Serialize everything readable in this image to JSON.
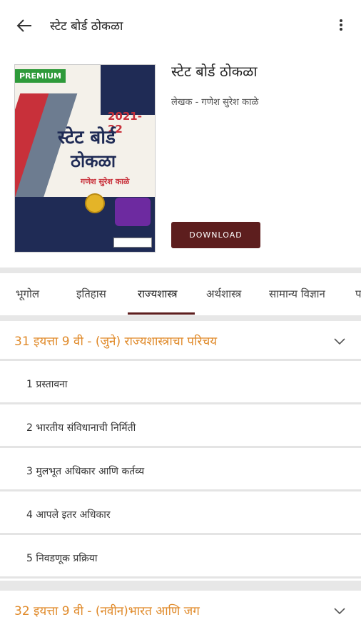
{
  "appbar": {
    "title": "स्टेट बोर्ड ठोकळा"
  },
  "book": {
    "title": "स्टेट बोर्ड ठोकळा",
    "author": "लेखक - गणेश सुरेश काळे",
    "download_label": "DOWNLOAD",
    "cover": {
      "premium": "PREMIUM",
      "year": "2021-22",
      "title_line1": "स्टेट बोर्ड",
      "title_line2": "ठोकळा",
      "author_line": "गणेश सुरेश काळे"
    }
  },
  "tabs": [
    {
      "label": "भूगोल"
    },
    {
      "label": "इतिहास"
    },
    {
      "label": "राज्यशास्त्र"
    },
    {
      "label": "अर्थशास्त्र"
    },
    {
      "label": "सामान्य विज्ञान"
    },
    {
      "label": "प"
    }
  ],
  "chapters": [
    {
      "title": "31 इयत्ता 9 वी - (जुने) राज्यशास्त्राचा परिचय",
      "lessons": [
        {
          "label": "1 प्रस्तावना"
        },
        {
          "label": "2 भारतीय संविधानाची निर्मिती"
        },
        {
          "label": "3 मुलभूत अधिकार आणि कर्तव्य"
        },
        {
          "label": "4 आपले इतर अधिकार"
        },
        {
          "label": "5 निवडणूक प्रक्रिया"
        }
      ]
    },
    {
      "title": "32 इयत्ता 9 वी - (नवीन)भारत आणि जग",
      "lessons": []
    }
  ],
  "colors": {
    "accent": "#5d1e1e",
    "chapter": "#e08a2a"
  }
}
